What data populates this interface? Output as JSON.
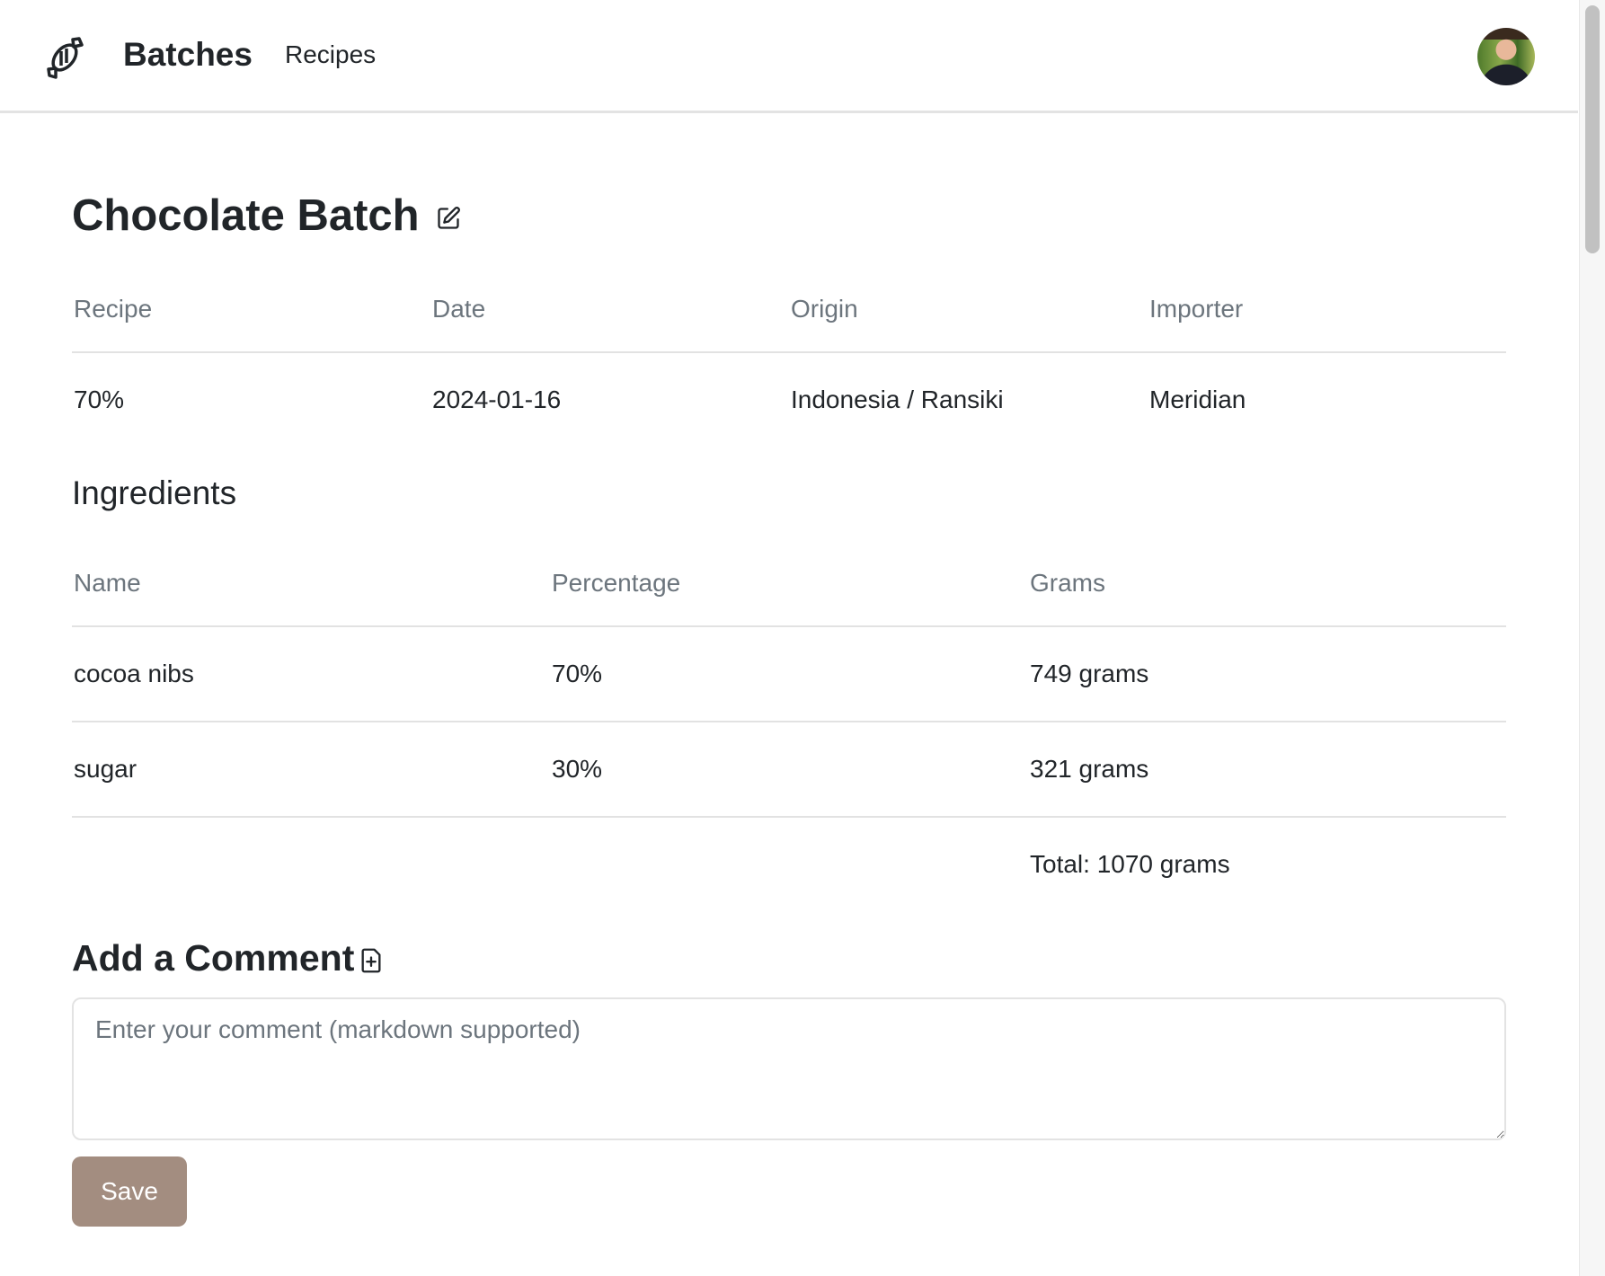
{
  "nav": {
    "brand": "Batches",
    "recipes": "Recipes"
  },
  "batch": {
    "title": "Chocolate Batch"
  },
  "summary": {
    "headers": [
      "Recipe",
      "Date",
      "Origin",
      "Importer"
    ],
    "values": [
      "70%",
      "2024-01-16",
      "Indonesia / Ransiki",
      "Meridian"
    ]
  },
  "ingredients": {
    "heading": "Ingredients",
    "headers": [
      "Name",
      "Percentage",
      "Grams"
    ],
    "rows": [
      [
        "cocoa nibs",
        "70%",
        "749 grams"
      ],
      [
        "sugar",
        "30%",
        "321 grams"
      ]
    ],
    "total": "Total: 1070 grams"
  },
  "comment": {
    "heading": "Add a Comment",
    "placeholder": "Enter your comment (markdown supported)",
    "value": "",
    "save_label": "Save"
  },
  "colors": {
    "save_button": "#a38d80",
    "muted_text": "#6c757d"
  }
}
